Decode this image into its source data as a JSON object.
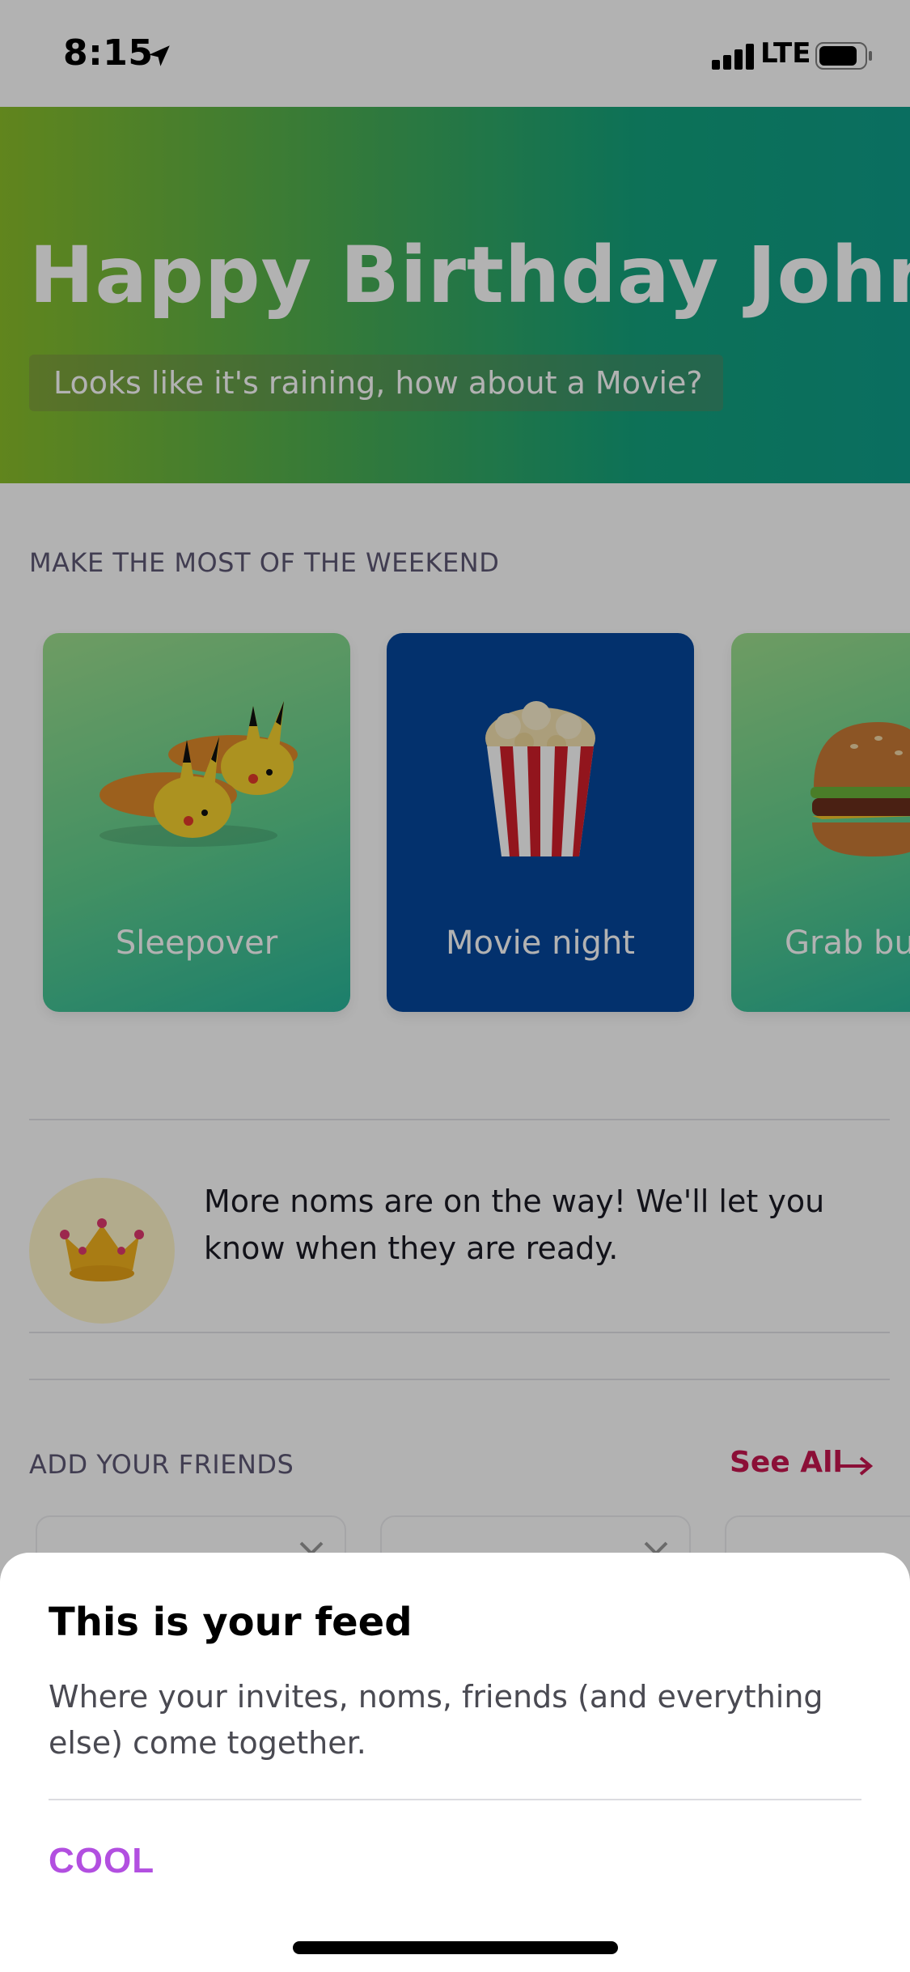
{
  "status_bar": {
    "time": "8:15",
    "network": "LTE",
    "icons": [
      "location-arrow-icon",
      "signal-icon",
      "battery-icon"
    ]
  },
  "hero": {
    "title": "Happy Birthday John!",
    "subtitle": "Looks like it's raining, how about a Movie?"
  },
  "weekend": {
    "section_title": "MAKE THE MOST OF THE WEEKEND",
    "cards": [
      {
        "label": "Sleepover",
        "icon": "slippers-icon"
      },
      {
        "label": "Movie night",
        "icon": "popcorn-icon"
      },
      {
        "label": "Grab bu",
        "icon": "burger-icon"
      }
    ]
  },
  "noms_notice": {
    "icon": "crown-icon",
    "text": "More noms are on the way! We'll let you know when they are ready."
  },
  "friends": {
    "section_title": "ADD YOUR FRIENDS",
    "see_all_label": "See All"
  },
  "sheet": {
    "title": "This is your feed",
    "body": "Where your invites, noms, friends (and everything else) come together.",
    "button_label": "COOL"
  },
  "colors": {
    "accent_red": "#c8164f",
    "button_purple": "#b24fe0",
    "movie_card": "#05479c",
    "overlay": "rgba(0,0,0,0.30)"
  }
}
